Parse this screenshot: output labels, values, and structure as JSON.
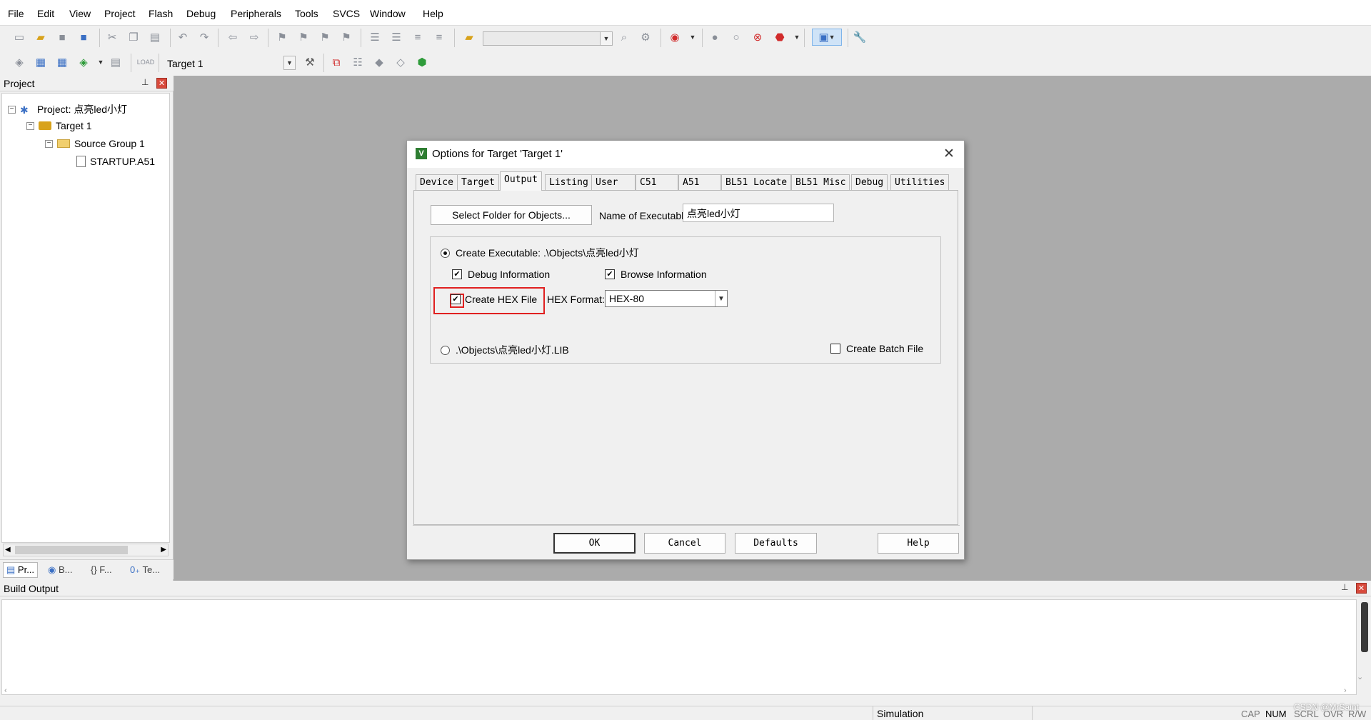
{
  "menu": [
    "File",
    "Edit",
    "View",
    "Project",
    "Flash",
    "Debug",
    "Peripherals",
    "Tools",
    "SVCS",
    "Window",
    "Help"
  ],
  "toolbar": {
    "target_name": "Target 1",
    "find_combo_value": ""
  },
  "project_panel": {
    "title": "Project",
    "tree": {
      "project": "Project: 点亮led小灯",
      "target": "Target 1",
      "group": "Source Group 1",
      "file": "STARTUP.A51"
    },
    "tabs": [
      "Pr...",
      "B...",
      "{} F...",
      "Te..."
    ]
  },
  "dialog": {
    "title": "Options for Target 'Target 1'",
    "tabs": [
      "Device",
      "Target",
      "Output",
      "Listing",
      "User",
      "C51",
      "A51",
      "BL51 Locate",
      "BL51 Misc",
      "Debug",
      "Utilities"
    ],
    "active_tab": "Output",
    "select_folder_label": "Select Folder for Objects...",
    "name_exec_label": "Name of Executable:",
    "name_exec_value": "点亮led小灯",
    "create_exec_label": "Create Executable:  .\\Objects\\点亮led小灯",
    "debug_info_label": "Debug Information",
    "browse_info_label": "Browse Information",
    "create_hex_label": "Create HEX File",
    "hex_format_label": "HEX Format:",
    "hex_format_value": "HEX-80",
    "create_lib_label": ".\\Objects\\点亮led小灯.LIB",
    "create_batch_label": "Create Batch File",
    "buttons": {
      "ok": "OK",
      "cancel": "Cancel",
      "defaults": "Defaults",
      "help": "Help"
    },
    "checks": {
      "debug_info": true,
      "browse_info": true,
      "create_hex": true,
      "create_batch": false
    },
    "radio_selected": "create_executable",
    "highlight_color": "#e02020"
  },
  "build_output": {
    "title": "Build Output"
  },
  "status": {
    "mode": "Simulation",
    "cap": "CAP",
    "num": "NUM",
    "scrl": "SCRL",
    "ovr": "OVR",
    "rw": "R/W",
    "watermark": "CSDN @MrSaint"
  }
}
